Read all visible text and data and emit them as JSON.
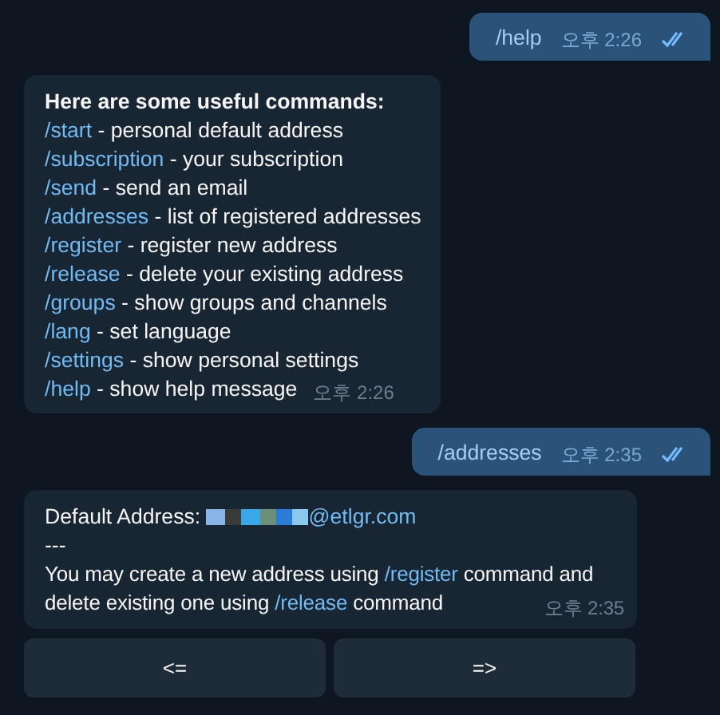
{
  "messages": [
    {
      "kind": "outgoing",
      "text": "/help",
      "time": "오후 2:26",
      "read": true
    },
    {
      "kind": "help",
      "title": "Here are some useful commands:",
      "commands": [
        {
          "command": "/start",
          "description": " - personal default address"
        },
        {
          "command": "/subscription",
          "description": " - your subscription"
        },
        {
          "command": "/send",
          "description": " - send an email"
        },
        {
          "command": "/addresses",
          "description": " - list of registered addresses"
        },
        {
          "command": "/register",
          "description": " - register new address"
        },
        {
          "command": "/release",
          "description": " - delete your existing address"
        },
        {
          "command": "/groups",
          "description": " - show groups and channels"
        },
        {
          "command": "/lang",
          "description": " - set language"
        },
        {
          "command": "/settings",
          "description": " - show personal settings"
        },
        {
          "command": "/help",
          "description": " - show help message"
        }
      ],
      "time": "오후 2:26"
    },
    {
      "kind": "outgoing",
      "text": "/addresses",
      "time": "오후 2:35",
      "read": true
    },
    {
      "kind": "address",
      "label": "Default Address:",
      "email": "@etlgr.com",
      "separator": "---",
      "segments": [
        {
          "text": "You may create a new address using ",
          "link": false
        },
        {
          "text": "/register",
          "link": true
        },
        {
          "text": " command and delete existing one using ",
          "link": false
        },
        {
          "text": "/release",
          "link": true
        },
        {
          "text": " command",
          "link": false
        }
      ],
      "time": "오후 2:35",
      "buttons": [
        "<=",
        "=>"
      ]
    }
  ]
}
